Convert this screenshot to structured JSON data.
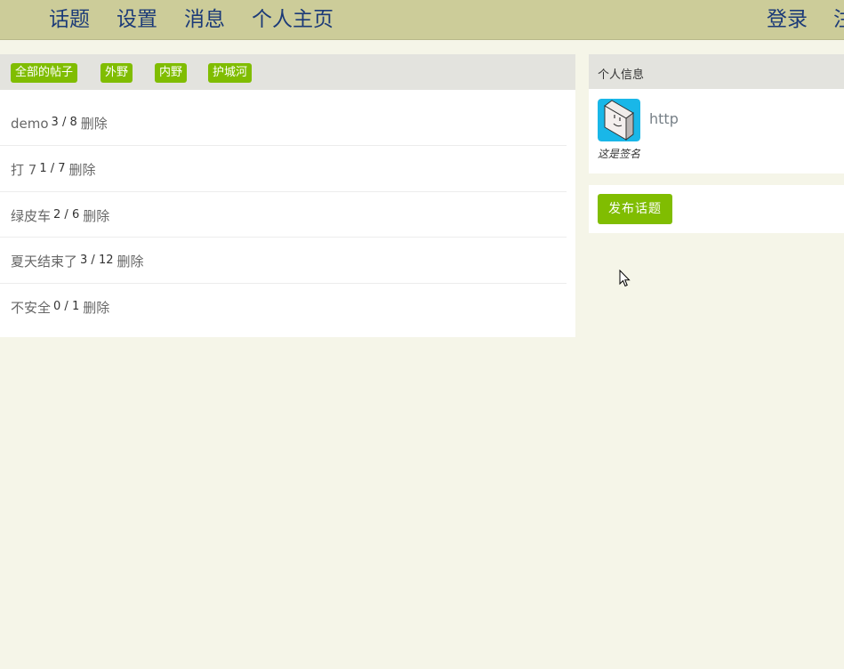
{
  "navbar": {
    "left_links": [
      "话题",
      "设置",
      "消息",
      "个人主页"
    ],
    "right_links": [
      "登录",
      "注"
    ],
    "bg_color": "#cccc99",
    "link_color": "#1b3a78"
  },
  "main": {
    "tabs": [
      "全部的帖子",
      "外野",
      "内野",
      "护城河"
    ],
    "tab_color": "#80bd01",
    "topics": [
      {
        "title": "demo",
        "replies": "3",
        "views": "8",
        "action": "删除"
      },
      {
        "title": "打 7",
        "replies": "1",
        "views": "7",
        "action": "删除"
      },
      {
        "title": "绿皮车",
        "replies": "2",
        "views": "6",
        "action": "删除"
      },
      {
        "title": "夏天结束了",
        "replies": "3",
        "views": "12",
        "action": "删除"
      },
      {
        "title": "不安全",
        "replies": "0",
        "views": "1",
        "action": "删除"
      }
    ]
  },
  "sidebar": {
    "header": "个人信息",
    "username": "http",
    "signature": "这是签名",
    "avatar_icon": "avatar-icon",
    "publish_label": "发布话题"
  }
}
